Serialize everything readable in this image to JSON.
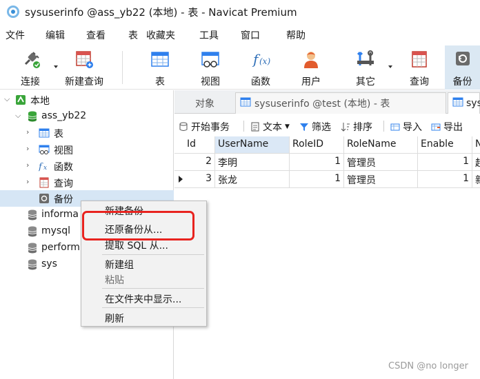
{
  "window": {
    "title": "sysuserinfo @ass_yb22 (本地) - 表 - Navicat Premium"
  },
  "menu": [
    "文件",
    "编辑",
    "查看",
    "表",
    "收藏夹",
    "工具",
    "窗口",
    "帮助"
  ],
  "toolbar": {
    "connect": "连接",
    "new_query": "新建查询",
    "table": "表",
    "view": "视图",
    "function": "函数",
    "user": "用户",
    "other": "其它",
    "query": "查询",
    "backup": "备份"
  },
  "tree": {
    "local": "本地",
    "db_ass": "ass_yb22",
    "node_table": "表",
    "node_view": "视图",
    "node_function": "函数",
    "node_query": "查询",
    "node_backup": "备份",
    "db_information": "informa",
    "db_mysql": "mysql",
    "db_performance": "perform",
    "db_sys": "sys"
  },
  "tabs": {
    "objects": "对象",
    "table_tab": "sysuserinfo @test (本地) - 表",
    "active_tab": "sys"
  },
  "subtoolbar": {
    "begin_tx": "开始事务",
    "text": "文本",
    "filter": "筛选",
    "sort": "排序",
    "import": "导入",
    "export": "导出"
  },
  "grid": {
    "columns": [
      "Id",
      "UserName",
      "RoleID",
      "RoleName",
      "Enable",
      "N"
    ],
    "rows": [
      {
        "Id": "2",
        "UserName": "李明",
        "RoleID": "1",
        "RoleName": "管理员",
        "Enable": "1",
        "N": "超"
      },
      {
        "Id": "3",
        "UserName": "张龙",
        "RoleID": "1",
        "RoleName": "管理员",
        "Enable": "1",
        "N": "新"
      }
    ]
  },
  "context_menu": {
    "new_backup": "新建备份",
    "restore_backup": "还原备份从...",
    "extract_sql": "提取 SQL 从...",
    "new_group": "新建组",
    "paste": "粘贴",
    "show_in_folder": "在文件夹中显示...",
    "refresh": "刷新"
  },
  "watermark": "CSDN @no longer",
  "colors": {
    "highlight": "#e8231f",
    "selection": "#d6e6f5",
    "db_green": "#3aa53a"
  }
}
